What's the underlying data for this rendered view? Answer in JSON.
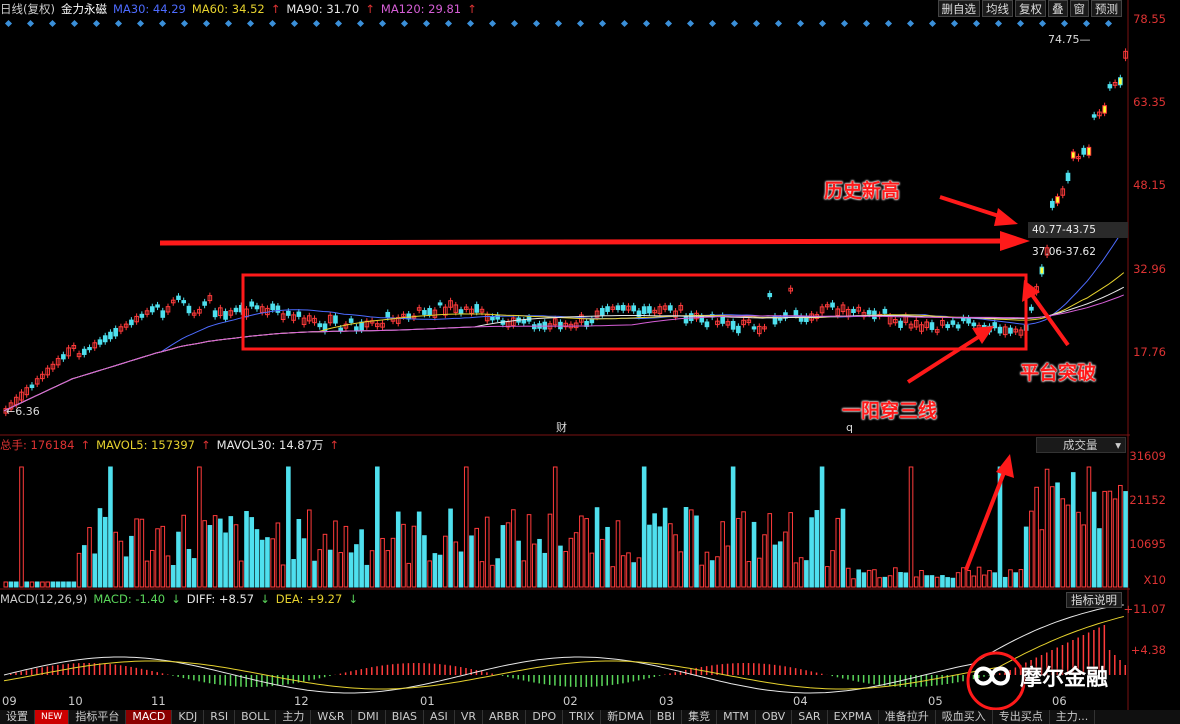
{
  "header": {
    "period": "日线(复权)",
    "stock_name": "金力永磁",
    "ma30": "MA30: 44.29",
    "ma60": "MA60: 34.52",
    "ma90": "MA90: 31.70",
    "ma120": "MA120: 29.81",
    "ma_colors": {
      "ma30": "#4d6bff",
      "ma60": "#e6d22e",
      "ma90": "#e8e8e8",
      "ma120": "#d65ed6"
    }
  },
  "toolbar": [
    "删自选",
    "均线",
    "复权",
    "叠",
    "窗",
    "预测"
  ],
  "price_axis": [
    "78.55",
    "63.35",
    "48.15",
    "32.96",
    "17.76"
  ],
  "markers": {
    "high": "74.75",
    "low": "6.36",
    "cai": "财",
    "q": "q"
  },
  "price_boxes": [
    "40.77-43.75",
    "37.06-37.62"
  ],
  "annotations": {
    "history_high": "历史新高",
    "platform_break": "平台突破",
    "one_yang": "一阳穿三线"
  },
  "volume": {
    "total": "总手: 176184",
    "mavol5": "MAVOL5: 157397",
    "mavol30": "MAVOL30: 14.87万",
    "selector": "成交量",
    "axis": [
      "31609",
      "21152",
      "10695",
      "X10"
    ]
  },
  "macd": {
    "title": "MACD(12,26,9)",
    "macd": "MACD: -1.40",
    "diff": "DIFF: +8.57",
    "dea": "DEA: +9.27",
    "help": "指标说明",
    "axis": [
      "+11.07",
      "+4.38"
    ]
  },
  "months": [
    "09",
    "10",
    "11",
    "12",
    "01",
    "02",
    "03",
    "04",
    "05",
    "06"
  ],
  "tabs": [
    "设置",
    "NEW",
    "指标平台",
    "MACD",
    "KDJ",
    "RSI",
    "BOLL",
    "主力",
    "W&R",
    "DMI",
    "BIAS",
    "ASI",
    "VR",
    "ARBR",
    "DPO",
    "TRIX",
    "新DMA",
    "BBI",
    "集竞",
    "MTM",
    "OBV",
    "SAR",
    "EXPMA",
    "准备拉升",
    "吸血买入",
    "专出买点",
    "主力..."
  ],
  "watermark": "摩尔金融"
}
